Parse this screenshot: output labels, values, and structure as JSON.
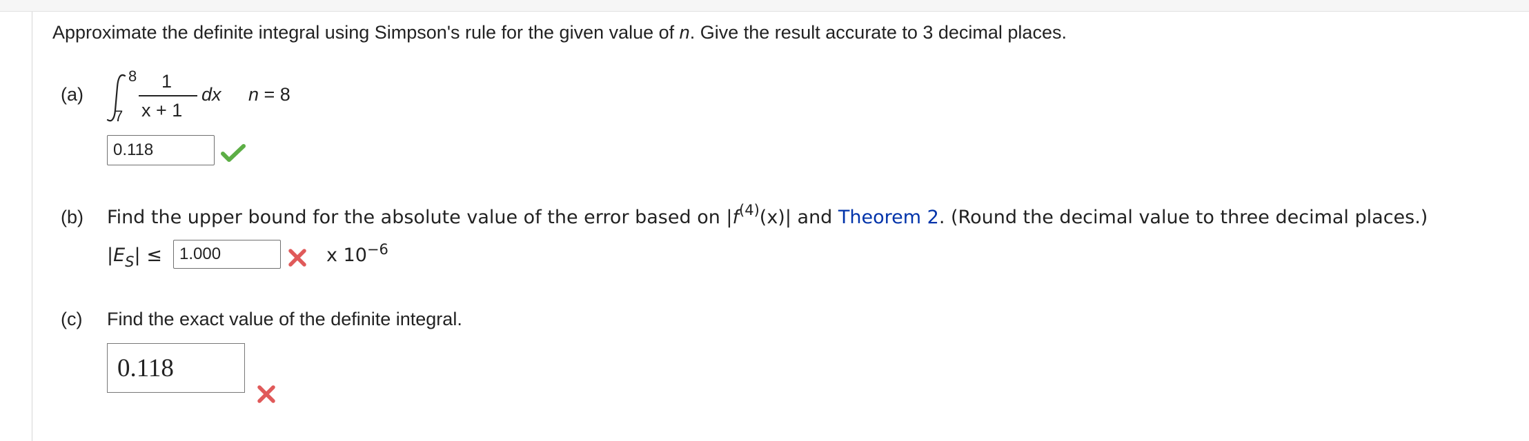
{
  "instructions": {
    "part1": "Approximate the definite integral using Simpson's rule for the given value of ",
    "n_var": "n",
    "part2": ". Give the result accurate to 3 decimal places."
  },
  "part_a": {
    "label": "(a)",
    "upper_limit": "8",
    "lower_limit": "7",
    "numerator": "1",
    "denominator": "x + 1",
    "dx": "dx",
    "n_var": "n",
    "n_eq": " = 8",
    "answer": "0.118",
    "status": "correct",
    "status_icon": "checkmark-icon",
    "status_color": "#5cae45"
  },
  "part_b": {
    "label": "(b)",
    "text_before": "Find the upper bound for the absolute value of the error based on |",
    "f": "f",
    "sup": "(4)",
    "fx": "(x)| and ",
    "link": "Theorem 2",
    "text_after": ". (Round the decimal value to three decimal places.)",
    "es_open": "|",
    "es_E": "E",
    "es_sub": "S",
    "es_close": "| ≤",
    "answer": "1.000",
    "status": "incorrect",
    "status_icon": "x-mark-icon",
    "status_color": "#e05a5a",
    "times": "x 10",
    "exp": "−6"
  },
  "part_c": {
    "label": "(c)",
    "text": "Find the exact value of the definite integral.",
    "answer": "0.118",
    "status": "incorrect",
    "status_icon": "x-mark-icon",
    "status_color": "#e05a5a"
  }
}
